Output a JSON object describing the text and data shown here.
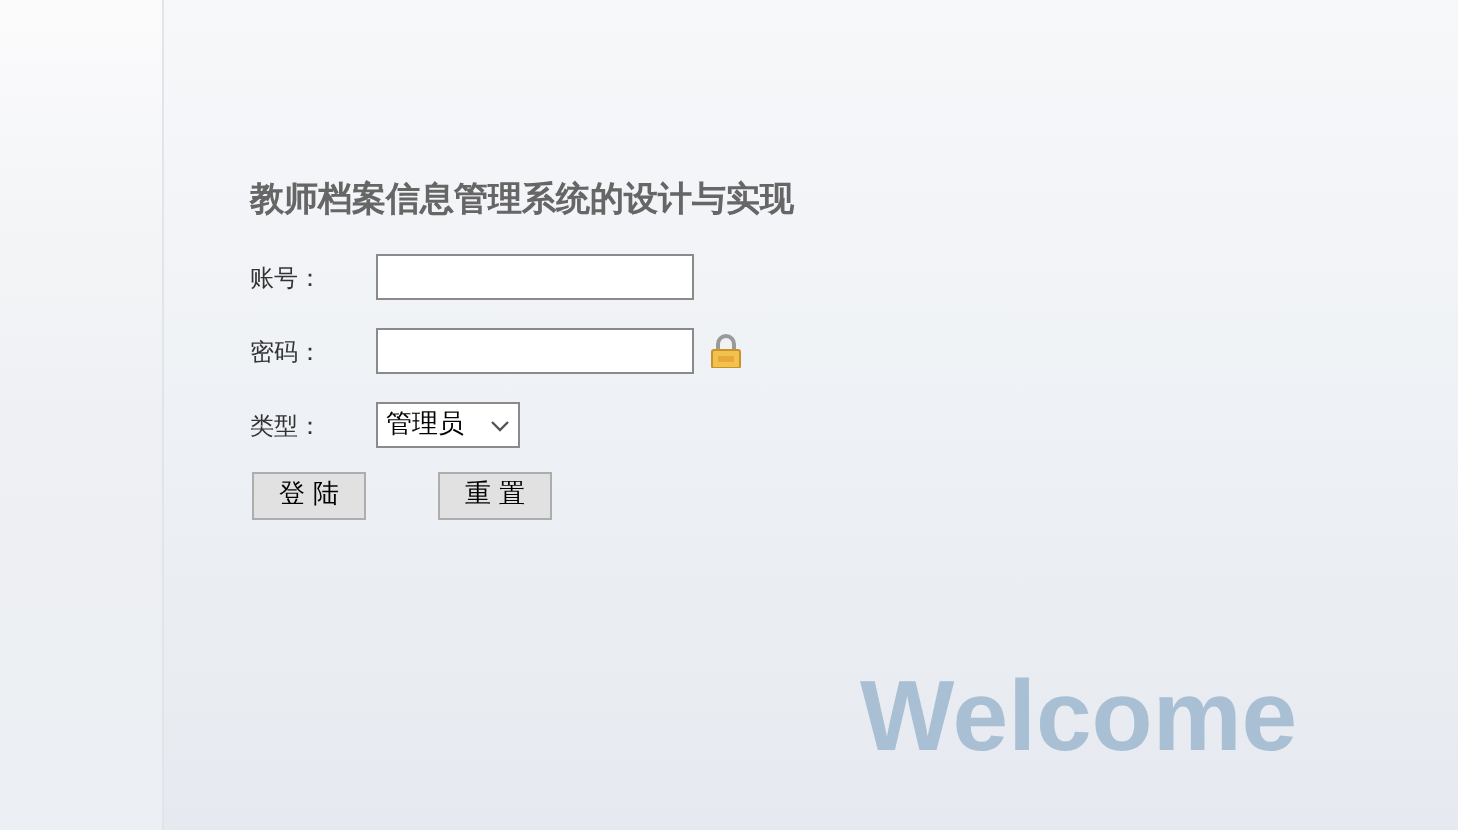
{
  "title": "教师档案信息管理系统的设计与实现",
  "fields": [
    {
      "label": "账号：",
      "kind": "text"
    },
    {
      "label": "密码：",
      "kind": "password"
    },
    {
      "label": "类型：",
      "kind": "select",
      "value": "管理员"
    }
  ],
  "buttons": [
    "登 陆",
    "重 置"
  ],
  "welcome": "Welcome"
}
